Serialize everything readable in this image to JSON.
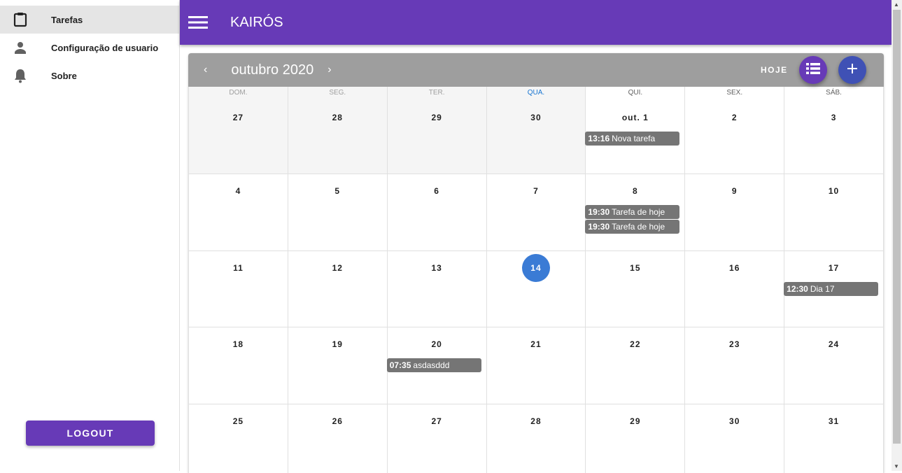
{
  "sidebar": {
    "items": [
      {
        "label": "Tarefas",
        "icon": "clipboard-icon",
        "active": true
      },
      {
        "label": "Configuração de usuario",
        "icon": "person-icon"
      },
      {
        "label": "Sobre",
        "icon": "bell-icon"
      }
    ],
    "logout": "LOGOUT"
  },
  "appbar": {
    "title": "KAIRÓS"
  },
  "calendar": {
    "month": "outubro 2020",
    "prev": "‹",
    "next": "›",
    "today_label": "HOJE",
    "weekdays": [
      "DOM.",
      "SEG.",
      "TER.",
      "QUA.",
      "QUI.",
      "SEX.",
      "SÁB."
    ],
    "weeks": [
      [
        {
          "label": "27",
          "outside": true
        },
        {
          "label": "28",
          "outside": true
        },
        {
          "label": "29",
          "outside": true
        },
        {
          "label": "30",
          "outside": true
        },
        {
          "label": "out. 1",
          "events": [
            {
              "time": "13:16",
              "name": "Nova tarefa"
            }
          ]
        },
        {
          "label": "2"
        },
        {
          "label": "3"
        }
      ],
      [
        {
          "label": "4"
        },
        {
          "label": "5"
        },
        {
          "label": "6"
        },
        {
          "label": "7"
        },
        {
          "label": "8",
          "events": [
            {
              "time": "19:30",
              "name": "Tarefa de hoje"
            },
            {
              "time": "19:30",
              "name": "Tarefa de hoje"
            }
          ]
        },
        {
          "label": "9"
        },
        {
          "label": "10"
        }
      ],
      [
        {
          "label": "11"
        },
        {
          "label": "12"
        },
        {
          "label": "13"
        },
        {
          "label": "14",
          "today": true
        },
        {
          "label": "15"
        },
        {
          "label": "16"
        },
        {
          "label": "17",
          "events": [
            {
              "time": "12:30",
              "name": "Dia 17"
            }
          ]
        }
      ],
      [
        {
          "label": "18"
        },
        {
          "label": "19"
        },
        {
          "label": "20",
          "events": [
            {
              "time": "07:35",
              "name": "asdasddd"
            }
          ]
        },
        {
          "label": "21"
        },
        {
          "label": "22"
        },
        {
          "label": "23"
        },
        {
          "label": "24"
        }
      ],
      [
        {
          "label": "25"
        },
        {
          "label": "26"
        },
        {
          "label": "27"
        },
        {
          "label": "28"
        },
        {
          "label": "29"
        },
        {
          "label": "30"
        },
        {
          "label": "31"
        }
      ]
    ]
  },
  "colors": {
    "primary": "#673ab7",
    "fab_add": "#3f51b5",
    "today": "#3a7bd5",
    "event": "#757575",
    "toolbar": "#9e9e9e"
  }
}
